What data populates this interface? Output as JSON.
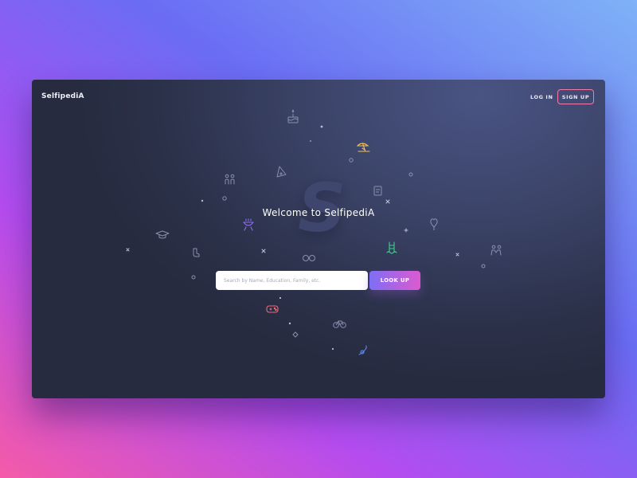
{
  "app": {
    "logo_text": "SelfipediA",
    "watermark_letter": "S"
  },
  "header": {
    "login_label": "LOG IN",
    "signup_label": "SIGN UP"
  },
  "hero": {
    "welcome_text": "Welcome to SelfipediA"
  },
  "search": {
    "placeholder": "Search by Name, Education, Family, etc.",
    "value": "",
    "button_label": "LOOK UP"
  },
  "colors": {
    "accent_pink": "#f07aa8",
    "button_gradient_start": "#7d6ef5",
    "button_gradient_end": "#dd5ad0",
    "icon_gray": "#8a90ad",
    "icon_yellow": "#f3c15a",
    "icon_purple": "#8f6cf0",
    "icon_green": "#3fd08e",
    "icon_red": "#f06b7a",
    "icon_blue": "#5c8ff0"
  },
  "decorative_icons": [
    "cake-icon",
    "beach-umbrella-icon",
    "pizza-icon",
    "couple-icon",
    "book-icon",
    "heart-balloon-icon",
    "bbq-grill-icon",
    "graduation-cap-icon",
    "swimming-pool-icon",
    "socks-icon",
    "glasses-icon",
    "friends-icon",
    "gamepad-icon",
    "bicycle-icon",
    "snorkel-icon"
  ]
}
